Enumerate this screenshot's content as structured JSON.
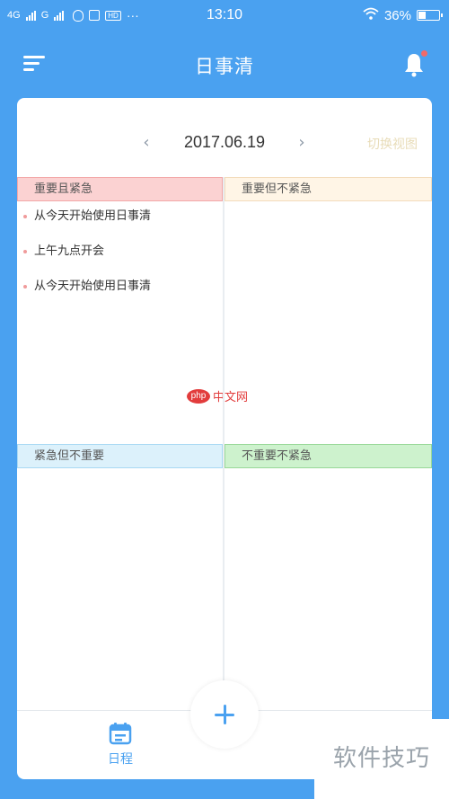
{
  "status_bar": {
    "network1": "4G",
    "network2": "G",
    "hd_badge": "HD",
    "dots": "···",
    "time": "13:10",
    "battery_text": "36%",
    "battery_level": 0.36
  },
  "header": {
    "title": "日事清"
  },
  "date_nav": {
    "prev_arrow": "‹",
    "date": "2017.06.19",
    "next_arrow": "›",
    "switch_view": "切换视图"
  },
  "quadrants": [
    {
      "label": "重要且紧急",
      "tasks": [
        "从今天开始使用日事清",
        "上午九点开会",
        "从今天开始使用日事清"
      ]
    },
    {
      "label": "重要但不紧急",
      "tasks": []
    },
    {
      "label": "紧急但不重要",
      "tasks": []
    },
    {
      "label": "不重要不紧急",
      "tasks": []
    }
  ],
  "watermark": {
    "logo_text": "php",
    "text": "中文网",
    "corner_text": "软件技巧"
  },
  "tabbar": {
    "schedule_label": "日程"
  },
  "colors": {
    "primary": "#4aa1f0",
    "q1": "#fbd2d2",
    "q2": "#fff5e6",
    "q3": "#dcf1fb",
    "q4": "#cdf2cd",
    "notification_dot": "#f06a6a"
  }
}
